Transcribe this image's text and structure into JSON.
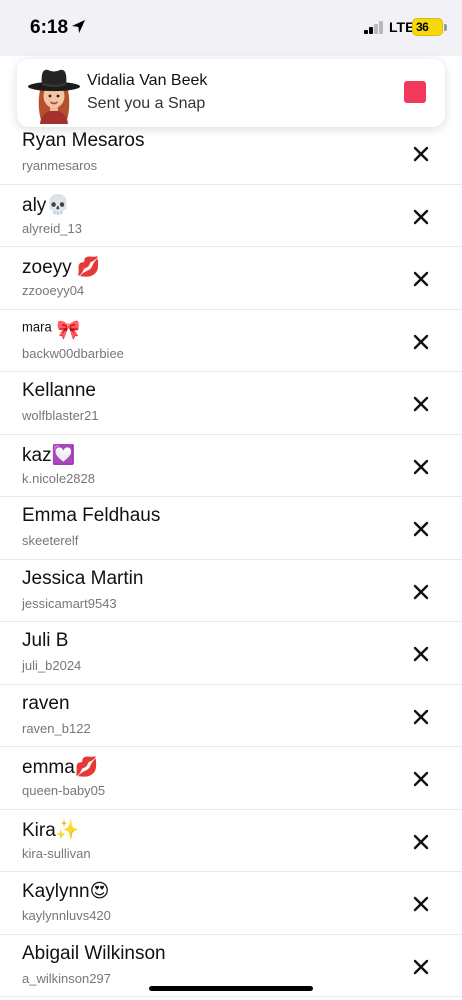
{
  "status_bar": {
    "time": "6:18",
    "network": "LTE",
    "battery": "36",
    "location_icon": "location-arrow-icon",
    "signal_bars_active": 2
  },
  "notification": {
    "name": "Vidalia Van Beek",
    "message": "Sent you a Snap",
    "avatar_icon": "cowgirl-bitmoji-avatar",
    "snap_color": "#f2395b"
  },
  "list": {
    "remove_icon": "close-icon",
    "items": [
      {
        "name": "Ryan Mesaros",
        "username": "ryanmesaros"
      },
      {
        "name": "aly💀",
        "username": "alyreid_13"
      },
      {
        "name": "zoeyy 💋",
        "username": "zzooeyy04"
      },
      {
        "name": "ᵐᵃʳᵃ 🎀",
        "username": "backw00dbarbiee"
      },
      {
        "name": "Kellanne",
        "username": "wolfblaster21"
      },
      {
        "name": "kaz💟",
        "username": "k.nicole2828"
      },
      {
        "name": "Emma Feldhaus",
        "username": "skeeterelf"
      },
      {
        "name": "Jessica Martin",
        "username": "jessicamart9543"
      },
      {
        "name": "Juli B",
        "username": "juli_b2024"
      },
      {
        "name": "raven",
        "username": "raven_b122"
      },
      {
        "name": "emma💋",
        "username": "queen-baby05"
      },
      {
        "name": "Kira✨",
        "username": "kira-sullivan"
      },
      {
        "name": "Kaylynn😍",
        "username": "kaylynnluvs420"
      },
      {
        "name": "Abigail Wilkinson",
        "username": "a_wilkinson297"
      }
    ]
  }
}
